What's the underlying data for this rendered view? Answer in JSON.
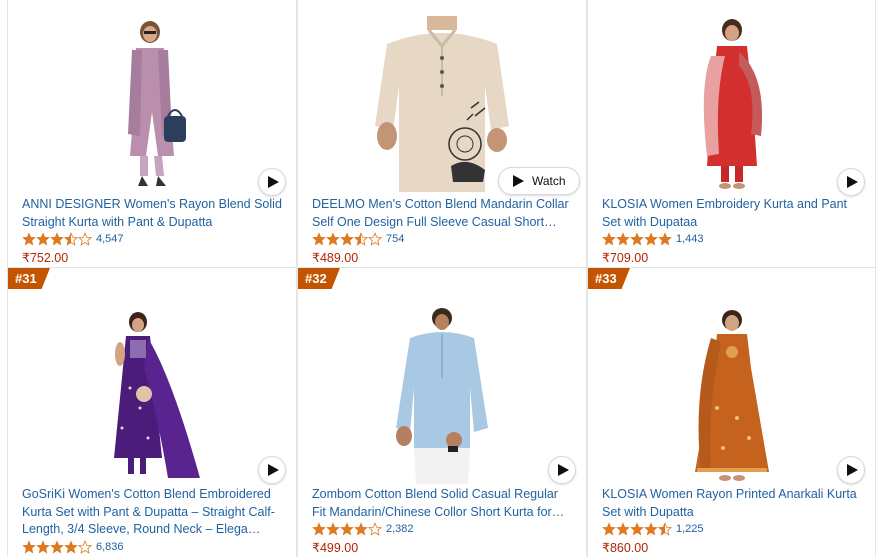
{
  "products": [
    {
      "rank": "",
      "title": "ANNI DESIGNER Women's Rayon Blend Solid Straight Kurta with Pant & Dupatta",
      "rating_value": 3.5,
      "rating_count": "4,547",
      "price": "₹752.00",
      "video_button": "play",
      "image": "woman-lilac-kurta-with-handbag"
    },
    {
      "rank": "",
      "title": "DEELMO Men's Cotton Blend Mandarin Collar Self One Design Full Sleeve Casual Short Kurta",
      "rating_value": 3.5,
      "rating_count": "754",
      "price": "₹489.00",
      "video_button": "watch",
      "watch_label": "Watch",
      "image": "man-beige-printed-shirt"
    },
    {
      "rank": "",
      "title": "KLOSIA Women Embroidery Kurta and Pant Set with Dupataa",
      "rating_value": 5,
      "rating_count": "1,443",
      "price": "₹709.00",
      "video_button": "play",
      "image": "woman-red-kurta-dupatta"
    },
    {
      "rank": "#31",
      "title": "GoSriKi Women's Cotton Blend Embroidered Kurta Set with Pant & Dupatta – Straight Calf-Length, 3/4 Sleeve, Round Neck – Elega…",
      "rating_value": 4,
      "rating_count": "6,836",
      "price": "",
      "video_button": "play",
      "image": "woman-purple-kurta-set"
    },
    {
      "rank": "#32",
      "title": "Zombom Cotton Blend Solid Casual Regular Fit Mandarin/Chinese Collor Short Kurta for Men",
      "rating_value": 4,
      "rating_count": "2,382",
      "price": "₹499.00",
      "video_button": "play",
      "image": "man-light-blue-kurta"
    },
    {
      "rank": "#33",
      "title": "KLOSIA Women Rayon Printed Anarkali Kurta Set with Dupatta",
      "rating_value": 4.5,
      "rating_count": "1,225",
      "price": "₹860.00",
      "video_button": "play",
      "image": "woman-orange-anarkali-kurta"
    }
  ],
  "colors": {
    "link": "#2162a1",
    "price": "#B12704",
    "star": "#de7921",
    "badge": "#c45500"
  }
}
